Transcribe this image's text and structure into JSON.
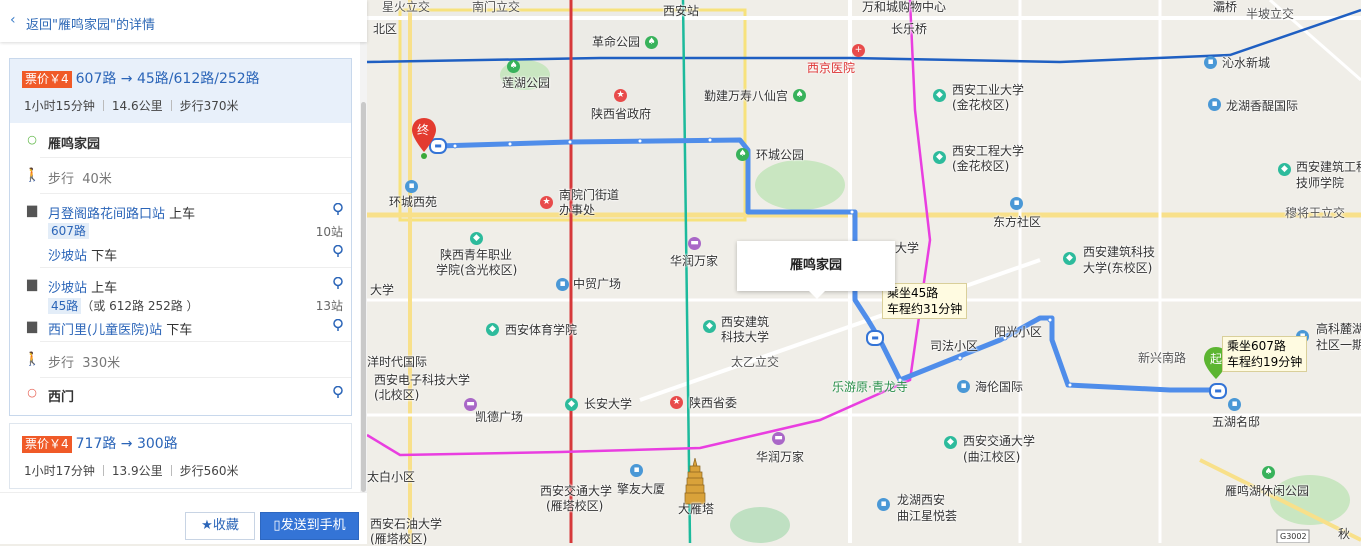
{
  "panel": {
    "back_link": "返回\"雁鸣家园\"的详情",
    "route1": {
      "fare": "票价￥4",
      "lines": "607路 → 45路/612路/252路",
      "duration": "1小时15分钟",
      "distance": "14.6公里",
      "walk": "步行370米",
      "steps": [
        {
          "type": "start",
          "text": "雁鸣家园"
        },
        {
          "type": "walk",
          "text": "步行",
          "distance": "40米"
        },
        {
          "type": "board",
          "station": "月登阁路花间路口站",
          "action": "上车"
        },
        {
          "type": "line",
          "line": "607路",
          "stops": "10站"
        },
        {
          "type": "alight",
          "station": "沙坡站",
          "action": "下车"
        },
        {
          "type": "board",
          "station": "沙坡站",
          "action": "上车"
        },
        {
          "type": "line",
          "line": "45路",
          "alt": "（或 612路 252路 ）",
          "stops": "13站"
        },
        {
          "type": "alight",
          "station": "西门里(儿童医院)站",
          "action": "下车"
        },
        {
          "type": "walk",
          "text": "步行",
          "distance": "330米"
        },
        {
          "type": "end",
          "text": "西门"
        }
      ]
    },
    "route2": {
      "fare": "票价￥4",
      "lines": "717路 → 300路",
      "duration": "1小时17分钟",
      "distance": "13.9公里",
      "walk": "步行560米"
    },
    "buttons": {
      "favorite": "收藏",
      "send": "发送到手机"
    }
  },
  "map": {
    "popup": "雁鸣家园",
    "callout1": [
      "乘坐45路",
      "车程约31分钟"
    ],
    "callout2": [
      "乘坐607路",
      "车程约19分钟"
    ],
    "marker_end": "终",
    "marker_start": "起",
    "shield": "G3002",
    "labels": {
      "l1": "西安站",
      "l2": "长乐桥",
      "l3": "革命公园",
      "l4": "西京医院",
      "l5": "沁水新城",
      "l6": "莲湖公园",
      "l7": "陕西省政府",
      "l8": "勤建万寿八仙宫",
      "l9": "西安工业大学",
      "l10": "(金花校区)",
      "l11": "龙湖香醍国际",
      "l12": "环城公园",
      "l13": "西安工程大学",
      "l14": "(金花校区)",
      "l15": "西安建筑工程",
      "l16": "技师学院",
      "l17": "环城西苑",
      "l18": "南院门街道",
      "l19": "办事处",
      "l20": "东方社区",
      "l21": "穆将王立交",
      "l22": "陕西青年职业",
      "l23": "学院(含光校区)",
      "l24": "华润万家",
      "l25": "西安建筑科技",
      "l26": "大学(东校区)",
      "l27": "中贸广场",
      "l28": "西安体育学院",
      "l29": "西安建筑",
      "l30": "科技大学",
      "l31": "司法小区",
      "l32": "阳光小区",
      "l33": "新兴南路",
      "l34": "高科麓湖",
      "l35": "社区一期",
      "l36": "太乙立交",
      "l37": "乐游原·青龙寺",
      "l38": "海伦国际",
      "l39": "五湖名邸",
      "l40": "西安电子科技大学",
      "l41": "(北校区)",
      "l42": "凯德广场",
      "l43": "长安大学",
      "l44": "陕西省委",
      "l45": "西安交通大学",
      "l46": "(曲江校区)",
      "l47": "华润万家",
      "l48": "雁鸣湖休闲公园",
      "l49": "太白小区",
      "l50": "西安交通大学",
      "l51": "(雁塔校区)",
      "l52": "擎友大厦",
      "l53": "大雁塔",
      "l54": "龙湖西安",
      "l55": "曲江星悦荟",
      "l56": "西安石油大学",
      "l57": "(雁塔校区)",
      "l58": "半坡立交",
      "l59": "北区",
      "l60": "大学",
      "l61": "大学",
      "l62": "洋时代国际",
      "l63": "星火立交",
      "l64": "南门立交",
      "l65": "万和城购物中心",
      "l66": "灞桥",
      "l67": "秋"
    }
  }
}
